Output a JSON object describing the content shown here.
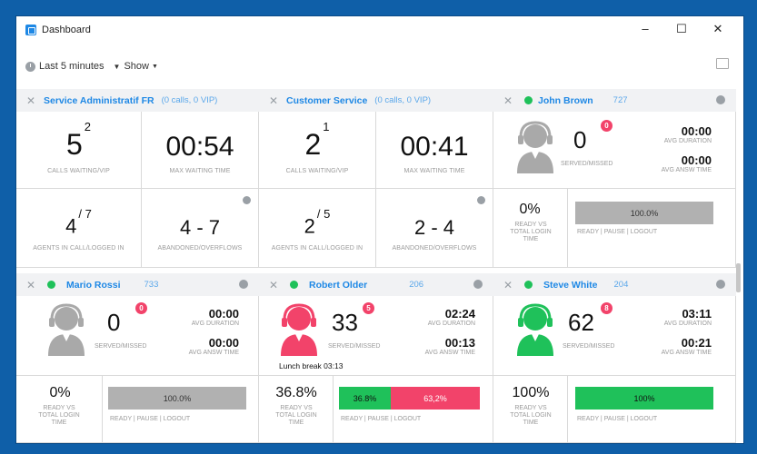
{
  "window": {
    "title": "Dashboard",
    "min": "–",
    "max": "☐",
    "close": "✕"
  },
  "toolbar": {
    "range": "Last 5 minutes",
    "show": "Show"
  },
  "queues": [
    {
      "name": "Service Administratif FR",
      "meta": "(0 calls, 0 VIP)",
      "calls_waiting": "5",
      "vip": "2",
      "calls_label": "CALLS WAITING/VIP",
      "max_wait": "00:54",
      "max_wait_label": "MAX WAITING TIME",
      "agents": "4",
      "agents_total": "/ 7",
      "agents_label": "AGENTS IN CALL/LOGGED IN",
      "ab": "4 - 7",
      "ab_label": "ABANDONED/OVERFLOWS"
    },
    {
      "name": "Customer Service",
      "meta": "(0 calls, 0 VIP)",
      "calls_waiting": "2",
      "vip": "1",
      "calls_label": "CALLS WAITING/VIP",
      "max_wait": "00:41",
      "max_wait_label": "MAX WAITING TIME",
      "agents": "2",
      "agents_total": "/ 5",
      "agents_label": "AGENTS IN CALL/LOGGED IN",
      "ab": "2 - 4",
      "ab_label": "ABANDONED/OVERFLOWS"
    }
  ],
  "agents": [
    {
      "name": "John Brown",
      "ext": "727",
      "served": "0",
      "missed": "0",
      "served_label": "SERVED/MISSED",
      "avg_dur": "00:00",
      "avg_dur_label": "AVG DURATION",
      "avg_answ": "00:00",
      "avg_answ_label": "AVG ANSW TIME",
      "ready_pct": "0%",
      "ready_label": "READY VS TOTAL LOGIN TIME",
      "bar_text": "100.0%",
      "bar_label": "READY | PAUSE | LOGOUT",
      "status_color": "#1fc15a",
      "avatar_color": "#a9a9a9"
    },
    {
      "name": "Mario Rossi",
      "ext": "733",
      "served": "0",
      "missed": "0",
      "served_label": "SERVED/MISSED",
      "avg_dur": "00:00",
      "avg_dur_label": "AVG DURATION",
      "avg_answ": "00:00",
      "avg_answ_label": "AVG ANSW TIME",
      "ready_pct": "0%",
      "ready_label": "READY VS TOTAL LOGIN TIME",
      "bar_text": "100.0%",
      "bar_label": "READY | PAUSE | LOGOUT",
      "status_color": "#1fc15a",
      "avatar_color": "#a9a9a9"
    },
    {
      "name": "Robert Older",
      "ext": "206",
      "served": "33",
      "missed": "5",
      "served_label": "SERVED/MISSED",
      "avg_dur": "02:24",
      "avg_dur_label": "AVG DURATION",
      "avg_answ": "00:13",
      "avg_answ_label": "AVG ANSW TIME",
      "lunch": "Lunch break 03:13",
      "ready_pct": "36.8%",
      "ready_label": "READY VS TOTAL LOGIN TIME",
      "bar_a": "36.8%",
      "bar_b": "63,2%",
      "bar_label": "READY | PAUSE | LOGOUT",
      "status_color": "#1fc15a",
      "avatar_color": "#f2436a"
    },
    {
      "name": "Steve White",
      "ext": "204",
      "served": "62",
      "missed": "8",
      "served_label": "SERVED/MISSED",
      "avg_dur": "03:11",
      "avg_dur_label": "AVG DURATION",
      "avg_answ": "00:21",
      "avg_answ_label": "AVG ANSW TIME",
      "ready_pct": "100%",
      "ready_label": "READY VS TOTAL LOGIN TIME",
      "bar_text": "100%",
      "bar_label": "READY | PAUSE | LOGOUT",
      "status_color": "#1fc15a",
      "avatar_color": "#1fc15a"
    }
  ],
  "colors": {
    "accent": "#1e88e5",
    "ready": "#1fc15a",
    "pause": "#f2436a",
    "neutral_bar": "#b1b1b1"
  }
}
